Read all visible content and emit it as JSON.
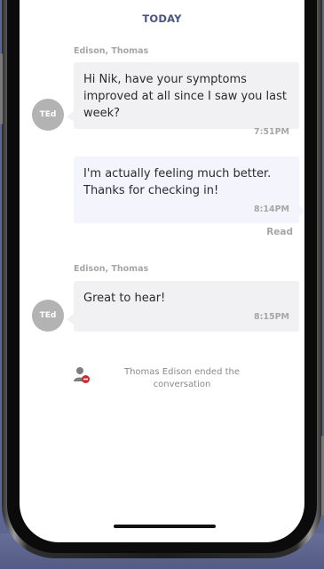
{
  "conversation": {
    "day_header": "TODAY",
    "messages": [
      {
        "sender": "Edison, Thomas",
        "initials": "TEd",
        "text": "Hi Nik, have your symptoms improved at all since I saw you last week?",
        "time": "7:51PM"
      },
      {
        "text": "I'm actually feeling much better. Thanks for checking in!",
        "time": "8:14PM",
        "status": "Read"
      },
      {
        "sender": "Edison, Thomas",
        "initials": "TEd",
        "text": "Great to hear!",
        "time": "8:15PM"
      }
    ],
    "system_event": {
      "icon": "user-ended-icon",
      "text": "Thomas Edison ended the conversation"
    }
  },
  "colors": {
    "backdrop": "#5d6690",
    "accent": "#4a5680",
    "incoming_bubble": "#f1f1f3",
    "outgoing_bubble": "#f3f4fc",
    "avatar": "#b3b3b3",
    "muted_text": "#a6a6a6",
    "end_icon_badge": "#cc2a2a"
  }
}
